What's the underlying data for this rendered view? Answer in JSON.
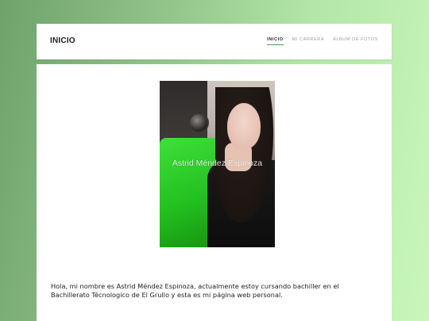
{
  "header": {
    "site_title": "INICIO",
    "nav": [
      {
        "label": "INICIO",
        "active": true
      },
      {
        "label": "MI CARRERA",
        "active": false
      },
      {
        "label": "ÁLBUM DE FOTOS",
        "active": false
      }
    ]
  },
  "main": {
    "photo": {
      "watermark": "Astrid Méndez Espinoza"
    },
    "intro_text": "Hola, mi nombre es Astrid Méndez Espinoza, actualmente estoy cursando bachiller en el Bachillerato Técnologico de El Grullo y esta es mi página web personal."
  },
  "colors": {
    "accent": "#3fa14a",
    "background_left": "#6fa26b",
    "background_right": "#c8f7b9"
  }
}
